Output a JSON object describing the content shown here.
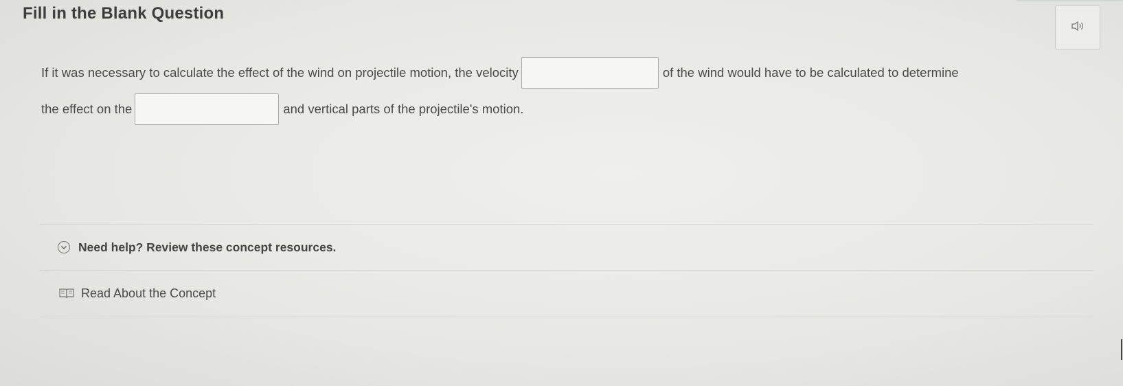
{
  "header": {
    "title": "Fill in the Blank Question",
    "audio_icon": "speaker-icon"
  },
  "question": {
    "line1_before": "If it was necessary to calculate the effect of the wind on projectile motion, the velocity",
    "line1_after": "of the wind would have to be calculated to determine",
    "line2_before": "the effect on the",
    "line2_after": "and vertical parts of the projectile's motion.",
    "blank1_value": "",
    "blank2_value": ""
  },
  "help": {
    "toggle_icon": "chevron-down-circle-icon",
    "title": "Need help? Review these concept resources.",
    "resources": [
      {
        "icon": "book-icon",
        "label": "Read About the Concept"
      }
    ]
  }
}
